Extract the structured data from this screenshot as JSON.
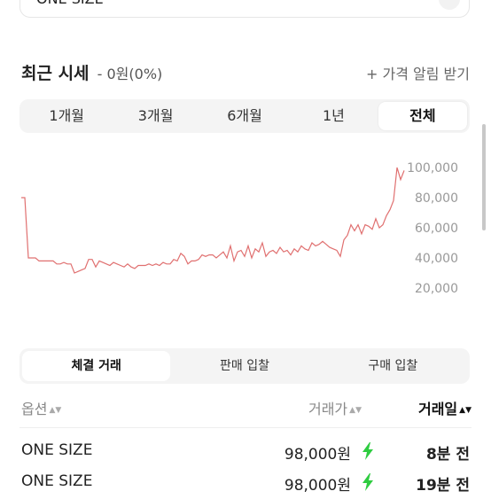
{
  "selector": {
    "value": "ONE SIZE"
  },
  "header": {
    "title": "최근 시세",
    "change": "- 0원(0%)",
    "alert": "+ 가격 알림 받기"
  },
  "period_tabs": [
    "1개월",
    "3개월",
    "6개월",
    "1년",
    "전체"
  ],
  "trade_tabs": [
    "체결 거래",
    "판매 입찰",
    "구매 입찰"
  ],
  "table": {
    "headers": {
      "option": "옵션",
      "price": "거래가",
      "date": "거래일"
    },
    "rows": [
      {
        "option": "ONE SIZE",
        "price": "98,000원",
        "date": "8분 전"
      },
      {
        "option": "ONE SIZE",
        "price": "98,000원",
        "date": "19분 전"
      }
    ]
  },
  "colors": {
    "line": "#e07070",
    "bolt": "#2ecc40",
    "label": "#999999"
  },
  "chart_data": {
    "type": "line",
    "y_ticks": [
      "100,000",
      "80,000",
      "60,000",
      "40,000",
      "20,000"
    ],
    "ylim": [
      20000,
      100000
    ],
    "y": [
      80000,
      80000,
      40000,
      40000,
      40000,
      38000,
      38000,
      38000,
      38000,
      38000,
      36000,
      36000,
      37000,
      36000,
      36000,
      30000,
      31000,
      32000,
      33000,
      39000,
      39000,
      34000,
      38000,
      37000,
      36000,
      35000,
      37000,
      36000,
      35000,
      34000,
      36000,
      34000,
      33000,
      35000,
      35000,
      35000,
      36000,
      35000,
      36000,
      35000,
      37000,
      36000,
      36000,
      39000,
      38000,
      43000,
      41000,
      36000,
      38000,
      38000,
      39000,
      42000,
      41000,
      42000,
      42000,
      40000,
      42000,
      44000,
      40000,
      48000,
      38000,
      44000,
      45000,
      41000,
      48000,
      40000,
      46000,
      44000,
      50000,
      41000,
      44000,
      45000,
      43000,
      47000,
      44000,
      45000,
      42000,
      46000,
      44000,
      48000,
      46000,
      45000,
      50000,
      48000,
      49000,
      51000,
      49000,
      47000,
      46000,
      45000,
      41000,
      52000,
      55000,
      62000,
      58000,
      62000,
      56000,
      62000,
      61000,
      59000,
      66000,
      60000,
      62000,
      68000,
      72000,
      78000,
      100000,
      92000,
      98000
    ]
  }
}
